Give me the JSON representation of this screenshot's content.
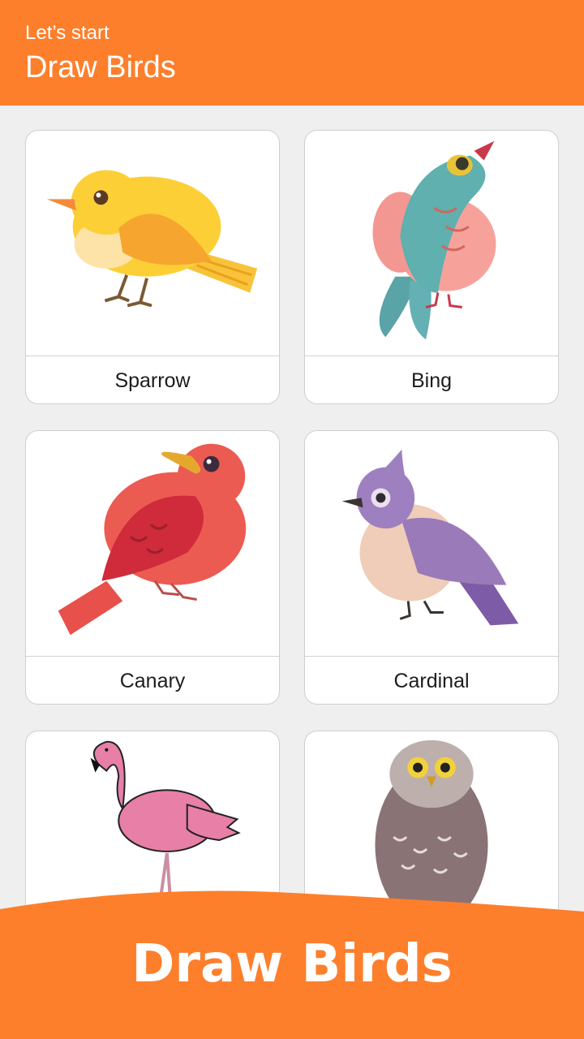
{
  "header": {
    "subtitle": "Let’s start",
    "title": "Draw Birds"
  },
  "cards": [
    {
      "label": "Sparrow",
      "icon": "sparrow-icon"
    },
    {
      "label": "Bing",
      "icon": "bing-icon"
    },
    {
      "label": "Canary",
      "icon": "canary-icon"
    },
    {
      "label": "Cardinal",
      "icon": "cardinal-icon"
    },
    {
      "label": "",
      "icon": "flamingo-icon"
    },
    {
      "label": "",
      "icon": "owl-icon"
    }
  ],
  "banner": {
    "text": "Draw Birds"
  },
  "colors": {
    "accent": "#fd7f2c",
    "background": "#efefef",
    "card": "#ffffff"
  }
}
